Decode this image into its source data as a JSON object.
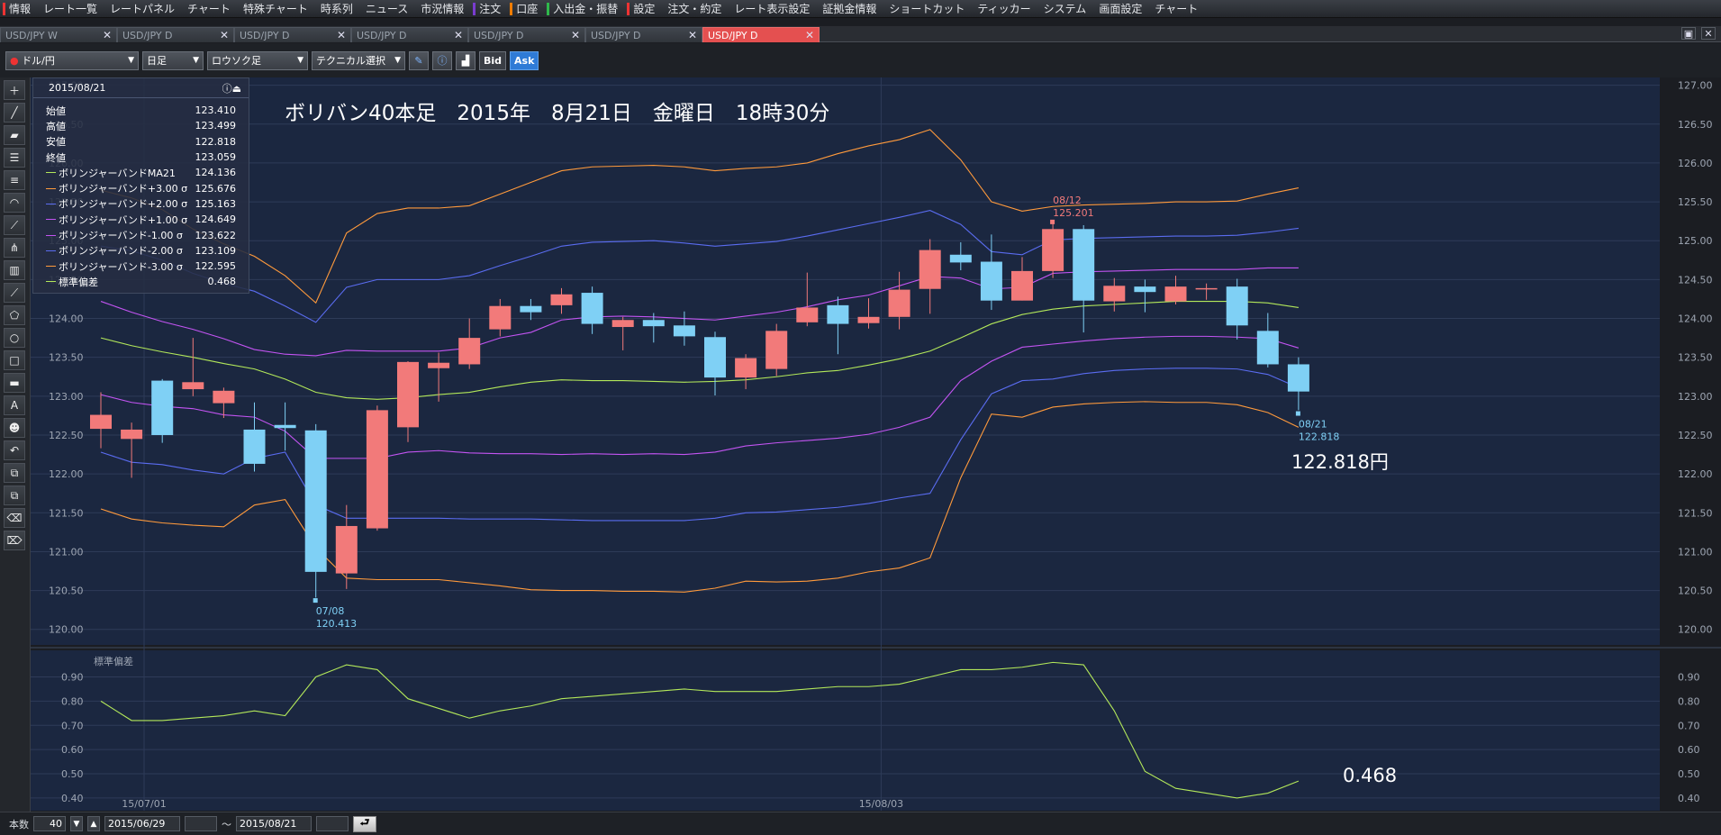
{
  "menu": [
    {
      "label": "情報",
      "mark": "#e33"
    },
    {
      "label": "レート一覧"
    },
    {
      "label": "レートパネル"
    },
    {
      "label": "チャート"
    },
    {
      "label": "特殊チャート"
    },
    {
      "label": "時系列"
    },
    {
      "label": "ニュース"
    },
    {
      "label": "市況情報"
    },
    {
      "label": "注文",
      "mark": "#7a3ccf"
    },
    {
      "label": "口座",
      "mark": "#f07c00"
    },
    {
      "label": "入出金・振替",
      "mark": "#2fb84b"
    },
    {
      "label": "設定",
      "mark": "#e33"
    },
    {
      "label": "注文・約定"
    },
    {
      "label": "レート表示設定"
    },
    {
      "label": "証拠金情報"
    },
    {
      "label": "ショートカット"
    },
    {
      "label": "ティッカー"
    },
    {
      "label": "システム"
    },
    {
      "label": "画面設定"
    },
    {
      "label": "チャート"
    }
  ],
  "tabs": [
    "USD/JPY W",
    "USD/JPY D",
    "USD/JPY D",
    "USD/JPY D",
    "USD/JPY D",
    "USD/JPY D",
    "USD/JPY D"
  ],
  "toolbar": {
    "currency_pair": "ドル/円",
    "timeframe": "日足",
    "chart_type": "ロウソク足",
    "technical": "テクニカル選択",
    "bid": "Bid",
    "ask": "Ask"
  },
  "info": {
    "date": "2015/08/21",
    "rows": [
      {
        "label": "始値",
        "value": "123.410"
      },
      {
        "label": "高値",
        "value": "123.499"
      },
      {
        "label": "安値",
        "value": "122.818"
      },
      {
        "label": "終値",
        "value": "123.059"
      },
      {
        "label": "ボリンジャーバンドMA21",
        "value": "124.136",
        "color": "#b3e85a"
      },
      {
        "label": "ボリンジャーバンド+3.00 σ",
        "value": "125.676",
        "color": "#ff9a3c"
      },
      {
        "label": "ボリンジャーバンド+2.00 σ",
        "value": "125.163",
        "color": "#5a6cf0"
      },
      {
        "label": "ボリンジャーバンド+1.00 σ",
        "value": "124.649",
        "color": "#c354f2"
      },
      {
        "label": "ボリンジャーバンド-1.00 σ",
        "value": "123.622",
        "color": "#c354f2"
      },
      {
        "label": "ボリンジャーバンド-2.00 σ",
        "value": "123.109",
        "color": "#5a6cf0"
      },
      {
        "label": "ボリンジャーバンド-3.00 σ",
        "value": "122.595",
        "color": "#ff9a3c"
      },
      {
        "label": "標準偏差",
        "value": "0.468",
        "color": "#b3e85a"
      }
    ]
  },
  "annotations": {
    "title": "ボリバン40本足　2015年　8月21日　金曜日　18時30分",
    "price": "122.818円",
    "stddev": "0.468",
    "high_date": "08/12",
    "high_value": "125.201",
    "low_date": "07/08",
    "low_value": "120.413",
    "last_date": "08/21",
    "last_value": "122.818"
  },
  "sub_label": "標準偏差",
  "date_labels": [
    {
      "index": 0,
      "label": "15/07/01"
    },
    {
      "index": 24,
      "label": "15/08/03"
    }
  ],
  "bottom": {
    "count_label": "本数",
    "count": "40",
    "from": "2015/06/29",
    "tilde": "～",
    "to": "2015/08/21"
  },
  "colors": {
    "up": "#f27a7a",
    "down": "#7fd0f5",
    "ma": "#b3e85a",
    "s3": "#ff9a3c",
    "s2": "#5a6cf0",
    "s1": "#c354f2",
    "sd": "#b3e85a",
    "bg": "#1b2740"
  },
  "chart_data": {
    "type": "candlestick",
    "y_range": [
      119.8,
      127.1
    ],
    "y_ticks": [
      120.0,
      120.5,
      121.0,
      121.5,
      122.0,
      122.5,
      123.0,
      123.5,
      124.0,
      124.5,
      125.0,
      125.5,
      126.0,
      126.5,
      127.0
    ],
    "sub_range": [
      0.37,
      0.98
    ],
    "sub_ticks": [
      0.4,
      0.5,
      0.6,
      0.7,
      0.8,
      0.9
    ],
    "candles": [
      [
        122.58,
        122.76,
        123.05,
        122.33
      ],
      [
        122.45,
        122.57,
        122.66,
        121.95
      ],
      [
        123.2,
        122.5,
        123.22,
        122.4
      ],
      [
        123.09,
        123.18,
        123.75,
        123.0
      ],
      [
        122.91,
        123.07,
        123.11,
        122.72
      ],
      [
        122.57,
        122.13,
        122.92,
        122.03
      ],
      [
        122.63,
        122.59,
        122.92,
        122.3
      ],
      [
        122.56,
        120.74,
        122.64,
        120.41
      ],
      [
        120.72,
        121.33,
        121.6,
        120.52
      ],
      [
        121.3,
        122.82,
        122.88,
        121.27
      ],
      [
        122.6,
        123.44,
        123.45,
        122.41
      ],
      [
        123.36,
        123.43,
        123.56,
        122.93
      ],
      [
        123.41,
        123.75,
        124.0,
        123.35
      ],
      [
        123.86,
        124.16,
        124.25,
        123.77
      ],
      [
        124.16,
        124.08,
        124.25,
        123.98
      ],
      [
        124.17,
        124.31,
        124.39,
        124.06
      ],
      [
        124.33,
        123.93,
        124.41,
        123.8
      ],
      [
        123.89,
        123.98,
        124.02,
        123.59
      ],
      [
        123.98,
        123.9,
        124.07,
        123.69
      ],
      [
        123.91,
        123.77,
        124.09,
        123.65
      ],
      [
        123.76,
        123.24,
        123.83,
        123.01
      ],
      [
        123.24,
        123.49,
        123.54,
        123.09
      ],
      [
        123.35,
        123.84,
        123.93,
        123.26
      ],
      [
        123.95,
        124.14,
        124.59,
        123.9
      ],
      [
        124.17,
        123.93,
        124.28,
        123.54
      ],
      [
        123.94,
        124.02,
        124.26,
        123.87
      ],
      [
        124.02,
        124.37,
        124.6,
        123.86
      ],
      [
        124.38,
        124.88,
        125.02,
        124.06
      ],
      [
        124.82,
        124.72,
        124.98,
        124.62
      ],
      [
        124.73,
        124.23,
        125.08,
        124.11
      ],
      [
        124.23,
        124.61,
        124.79,
        124.23
      ],
      [
        124.61,
        125.15,
        125.22,
        124.52
      ],
      [
        125.15,
        124.23,
        125.2,
        123.82
      ],
      [
        124.22,
        124.42,
        124.52,
        124.09
      ],
      [
        124.41,
        124.34,
        124.5,
        124.08
      ],
      [
        124.22,
        124.41,
        124.55,
        124.18
      ],
      [
        124.38,
        124.39,
        124.45,
        124.24
      ],
      [
        124.41,
        123.91,
        124.51,
        123.73
      ],
      [
        123.84,
        123.41,
        124.07,
        123.37
      ],
      [
        123.41,
        123.06,
        123.5,
        122.82
      ]
    ],
    "ma21": [
      123.75,
      123.65,
      123.57,
      123.5,
      123.42,
      123.35,
      123.22,
      123.05,
      122.98,
      122.96,
      122.98,
      123.02,
      123.05,
      123.12,
      123.18,
      123.21,
      123.2,
      123.2,
      123.19,
      123.18,
      123.19,
      123.21,
      123.25,
      123.3,
      123.33,
      123.4,
      123.48,
      123.58,
      123.75,
      123.93,
      124.05,
      124.12,
      124.16,
      124.18,
      124.2,
      124.22,
      124.22,
      124.22,
      124.2,
      124.14
    ],
    "p3": [
      125.65,
      125.55,
      125.4,
      125.15,
      124.96,
      124.8,
      124.55,
      124.2,
      125.1,
      125.35,
      125.42,
      125.42,
      125.45,
      125.6,
      125.75,
      125.9,
      125.95,
      125.96,
      125.97,
      125.95,
      125.9,
      125.93,
      125.95,
      126.0,
      126.12,
      126.22,
      126.3,
      126.43,
      126.04,
      125.5,
      125.38,
      125.44,
      125.46,
      125.47,
      125.48,
      125.5,
      125.5,
      125.51,
      125.6,
      125.68
    ],
    "p2": [
      124.93,
      124.87,
      124.75,
      124.58,
      124.45,
      124.35,
      124.16,
      123.95,
      124.4,
      124.5,
      124.5,
      124.5,
      124.55,
      124.68,
      124.8,
      124.93,
      124.98,
      124.99,
      125.0,
      124.97,
      124.93,
      124.96,
      124.99,
      125.06,
      125.14,
      125.22,
      125.3,
      125.39,
      125.21,
      124.86,
      124.82,
      125.01,
      125.03,
      125.04,
      125.05,
      125.06,
      125.06,
      125.07,
      125.11,
      125.16
    ],
    "p1": [
      124.22,
      124.08,
      123.96,
      123.86,
      123.74,
      123.6,
      123.54,
      123.52,
      123.59,
      123.58,
      123.58,
      123.58,
      123.62,
      123.75,
      123.82,
      123.98,
      124.02,
      124.03,
      124.02,
      124.0,
      123.98,
      124.03,
      124.08,
      124.15,
      124.24,
      124.3,
      124.42,
      124.54,
      124.52,
      124.38,
      124.4,
      124.58,
      124.6,
      124.61,
      124.62,
      124.63,
      124.63,
      124.63,
      124.65,
      124.65
    ],
    "m1": [
      123.02,
      122.92,
      122.87,
      122.84,
      122.76,
      122.73,
      122.55,
      122.2,
      122.2,
      122.2,
      122.28,
      122.3,
      122.27,
      122.26,
      122.26,
      122.25,
      122.26,
      122.25,
      122.26,
      122.25,
      122.28,
      122.36,
      122.4,
      122.43,
      122.46,
      122.51,
      122.6,
      122.73,
      123.2,
      123.45,
      123.63,
      123.67,
      123.71,
      123.74,
      123.76,
      123.77,
      123.77,
      123.76,
      123.74,
      123.62
    ],
    "m2": [
      122.28,
      122.15,
      122.12,
      122.05,
      122.0,
      122.2,
      122.28,
      121.6,
      121.43,
      121.43,
      121.43,
      121.43,
      121.42,
      121.42,
      121.42,
      121.41,
      121.4,
      121.4,
      121.4,
      121.4,
      121.43,
      121.5,
      121.51,
      121.54,
      121.57,
      121.62,
      121.69,
      121.75,
      122.44,
      123.03,
      123.2,
      123.22,
      123.29,
      123.33,
      123.35,
      123.36,
      123.36,
      123.35,
      123.28,
      123.11
    ],
    "m3": [
      121.55,
      121.42,
      121.37,
      121.34,
      121.32,
      121.6,
      121.67,
      121.05,
      120.66,
      120.64,
      120.64,
      120.64,
      120.6,
      120.56,
      120.51,
      120.5,
      120.5,
      120.49,
      120.49,
      120.48,
      120.53,
      120.62,
      120.61,
      120.62,
      120.66,
      120.74,
      120.79,
      120.92,
      121.95,
      122.77,
      122.73,
      122.86,
      122.9,
      122.92,
      122.93,
      122.92,
      122.92,
      122.89,
      122.79,
      122.6
    ],
    "stddev": [
      0.8,
      0.72,
      0.72,
      0.73,
      0.74,
      0.76,
      0.74,
      0.9,
      0.95,
      0.93,
      0.81,
      0.77,
      0.73,
      0.76,
      0.78,
      0.81,
      0.82,
      0.83,
      0.84,
      0.85,
      0.84,
      0.84,
      0.84,
      0.85,
      0.86,
      0.86,
      0.87,
      0.9,
      0.93,
      0.93,
      0.94,
      0.96,
      0.95,
      0.76,
      0.51,
      0.44,
      0.42,
      0.4,
      0.42,
      0.47
    ]
  }
}
